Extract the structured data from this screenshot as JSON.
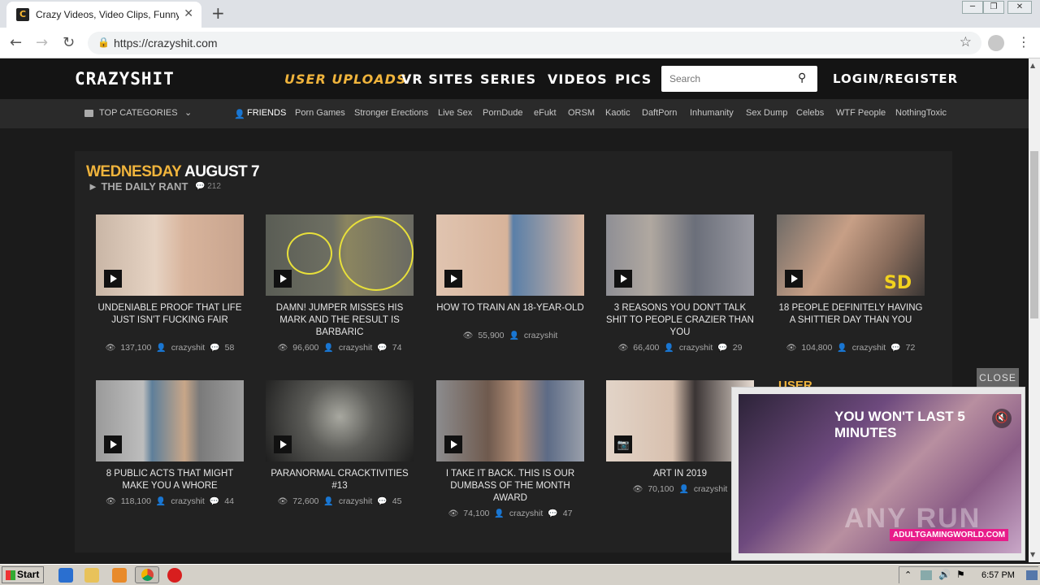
{
  "browser": {
    "tab_title": "Crazy Videos, Video Clips, Funny Vid",
    "tab_close": "✕",
    "new_tab": "+",
    "url": "https://crazyshit.com",
    "window_controls": [
      "─",
      "❐",
      "✕"
    ]
  },
  "site": {
    "logo": "CRAZYSHIT",
    "nav": [
      {
        "label": "USER UPLOADS",
        "active": true
      },
      {
        "label": "VR SITES"
      },
      {
        "label": "SERIES"
      },
      {
        "label": "VIDEOS"
      },
      {
        "label": "PICS"
      }
    ],
    "search_placeholder": "Search",
    "login": "LOGIN/REGISTER",
    "subnav": {
      "categories": "TOP CATEGORIES",
      "items": [
        "FRIENDS",
        "Porn Games",
        "Stronger Erections",
        "Live Sex",
        "PornDude",
        "eFukt",
        "ORSM",
        "Kaotic",
        "DaftPorn",
        "Inhumanity",
        "Sex Dump",
        "Celebs",
        "WTF People",
        "NothingToxic"
      ]
    }
  },
  "content": {
    "day": "WEDNESDAY",
    "date": "AUGUST 7",
    "rant": "► THE DAILY RANT",
    "rant_comments": "212",
    "cards": [
      {
        "title": "UNDENIABLE PROOF THAT LIFE JUST ISN'T FUCKING FAIR",
        "views": "137,100",
        "user": "crazyshit",
        "comments": "58",
        "type": "video"
      },
      {
        "title": "DAMN! JUMPER MISSES HIS MARK AND THE RESULT IS BARBARIC",
        "views": "96,600",
        "user": "crazyshit",
        "comments": "74",
        "type": "video"
      },
      {
        "title": "HOW TO TRAIN AN 18-YEAR-OLD",
        "views": "55,900",
        "user": "crazyshit",
        "comments": "",
        "type": "video"
      },
      {
        "title": "3 REASONS YOU DON'T TALK SHIT TO PEOPLE CRAZIER THAN YOU",
        "views": "66,400",
        "user": "crazyshit",
        "comments": "29",
        "type": "video"
      },
      {
        "title": "18 PEOPLE DEFINITELY HAVING A SHITTIER DAY THAN YOU",
        "views": "104,800",
        "user": "crazyshit",
        "comments": "72",
        "type": "video"
      },
      {
        "title": "8 PUBLIC ACTS THAT MIGHT MAKE YOU A WHORE",
        "views": "118,100",
        "user": "crazyshit",
        "comments": "44",
        "type": "video"
      },
      {
        "title": "PARANORMAL CRACKTIVITIES #13",
        "views": "72,600",
        "user": "crazyshit",
        "comments": "45",
        "type": "video"
      },
      {
        "title": "I TAKE IT BACK. THIS IS OUR DUMBASS OF THE MONTH AWARD",
        "views": "74,100",
        "user": "crazyshit",
        "comments": "47",
        "type": "video"
      },
      {
        "title": "ART IN 2019",
        "views": "70,100",
        "user": "crazyshit",
        "comments": "",
        "type": "pics"
      }
    ],
    "partial_label": "USER"
  },
  "ad": {
    "close": "CLOSE",
    "headline": "YOU WON'T LAST 5 MINUTES",
    "brand": "ADULTGAMINGWORLD.COM",
    "watermark": "ANY RUN"
  },
  "taskbar": {
    "start": "Start",
    "clock": "6:57 PM"
  },
  "colors": {
    "accent": "#f0b43c",
    "header_bg": "#141414",
    "panel_bg": "#222222"
  }
}
